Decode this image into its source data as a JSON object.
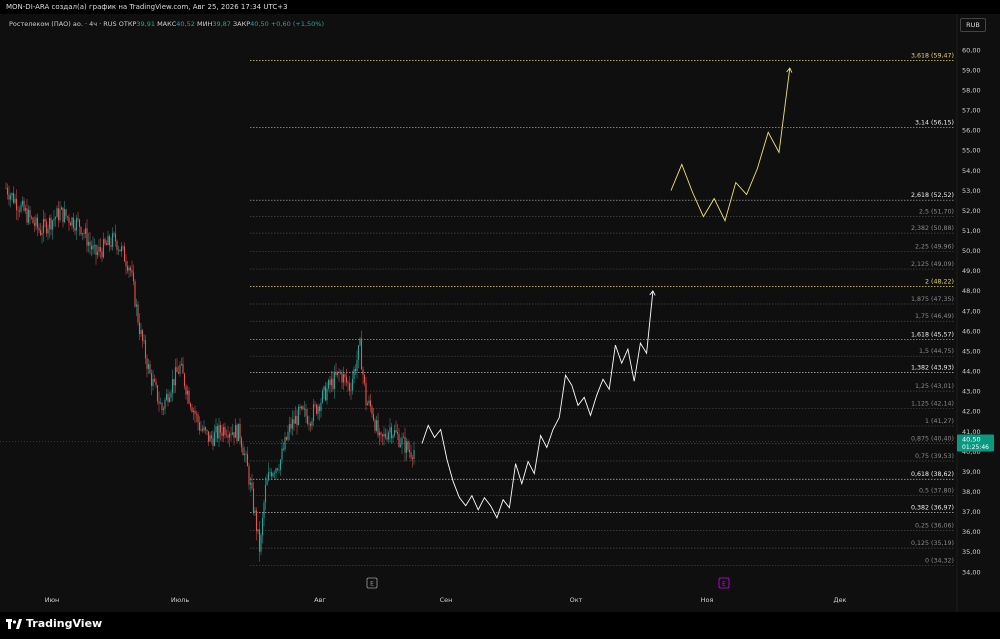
{
  "header": {
    "title": "MON-DI-ARA создал(а) график на TradingView.com, Авг 25, 2026 17:34 UTC+3"
  },
  "legend": {
    "symbol": "Ростелеком (ПАО) ао. · 4ч · RUS",
    "open_label": "ОТКР",
    "open": "39,91",
    "high_label": "МАКС",
    "high": "40,52",
    "low_label": "МИН",
    "low": "39,87",
    "close_label": "ЗАКР",
    "close": "40,50",
    "change": "+0,60 (+1,50%)"
  },
  "currency": "RUB",
  "price_badge": {
    "price": "40,50",
    "countdown": "01:25:46"
  },
  "colors": {
    "up": "#26a69a",
    "down": "#ef5350",
    "gold": "#e9d36b",
    "projection": "#ffffff",
    "projection2": "#f2e36b"
  },
  "y_axis": [
    "60,00",
    "59,00",
    "58,00",
    "57,00",
    "56,00",
    "55,00",
    "54,00",
    "53,00",
    "52,00",
    "51,00",
    "50,00",
    "49,00",
    "48,00",
    "47,00",
    "46,00",
    "45,00",
    "44,00",
    "43,00",
    "42,00",
    "41,00",
    "40,00",
    "39,00",
    "38,00",
    "37,00",
    "36,00",
    "35,00",
    "34,00"
  ],
  "x_axis": [
    "Июн",
    "Июль",
    "Авг",
    "Сен",
    "Окт",
    "Ноя",
    "Дек"
  ],
  "event_markers": [
    "E",
    "E"
  ],
  "fib_levels": [
    {
      "label": "3,618 (59,47)",
      "price": 59.47,
      "style": "gold"
    },
    {
      "label": "3,14 (56,15)",
      "price": 56.15,
      "style": "bright"
    },
    {
      "label": "2,618 (52,52)",
      "price": 52.52,
      "style": "bright"
    },
    {
      "label": "2,5 (51,70)",
      "price": 51.7,
      "style": "dim"
    },
    {
      "label": "2,382 (50,88)",
      "price": 50.88,
      "style": "dim"
    },
    {
      "label": "2,25 (49,96)",
      "price": 49.96,
      "style": "dim"
    },
    {
      "label": "2,125 (49,09)",
      "price": 49.09,
      "style": "dim"
    },
    {
      "label": "2 (48,22)",
      "price": 48.22,
      "style": "gold"
    },
    {
      "label": "1,875 (47,35)",
      "price": 47.35,
      "style": "dim"
    },
    {
      "label": "1,75 (46,49)",
      "price": 46.49,
      "style": "dim"
    },
    {
      "label": "1,618 (45,57)",
      "price": 45.57,
      "style": "bright"
    },
    {
      "label": "1,5 (44,75)",
      "price": 44.75,
      "style": "dim"
    },
    {
      "label": "1,382 (43,93)",
      "price": 43.93,
      "style": "bright"
    },
    {
      "label": "1,25 (43,01)",
      "price": 43.01,
      "style": "dim"
    },
    {
      "label": "1,125 (42,14)",
      "price": 42.14,
      "style": "dim"
    },
    {
      "label": "1 (41,27)",
      "price": 41.27,
      "style": "dim"
    },
    {
      "label": "0,875 (40,40)",
      "price": 40.4,
      "style": "dim"
    },
    {
      "label": "0,75 (39,53)",
      "price": 39.53,
      "style": "dim"
    },
    {
      "label": "0,618 (38,62)",
      "price": 38.62,
      "style": "bright"
    },
    {
      "label": "0,5 (37,80)",
      "price": 37.8,
      "style": "dim"
    },
    {
      "label": "0,382 (36,97)",
      "price": 36.97,
      "style": "bright"
    },
    {
      "label": "0,25 (36,06)",
      "price": 36.06,
      "style": "dim"
    },
    {
      "label": "0,125 (35,19)",
      "price": 35.19,
      "style": "dim"
    },
    {
      "label": "0 (34,32)",
      "price": 34.32,
      "style": "dim"
    }
  ],
  "projection_white": [
    [
      0,
      40.4
    ],
    [
      1,
      41.3
    ],
    [
      2,
      40.7
    ],
    [
      3,
      41.1
    ],
    [
      4,
      39.6
    ],
    [
      5,
      38.5
    ],
    [
      6,
      37.7
    ],
    [
      7,
      37.3
    ],
    [
      8,
      37.8
    ],
    [
      9,
      37.1
    ],
    [
      10,
      37.7
    ],
    [
      11,
      37.3
    ],
    [
      12,
      36.7
    ],
    [
      13,
      37.6
    ],
    [
      14,
      37.2
    ],
    [
      15,
      39.4
    ],
    [
      16,
      38.4
    ],
    [
      17,
      39.5
    ],
    [
      18,
      38.9
    ],
    [
      19,
      40.8
    ],
    [
      20,
      40.2
    ],
    [
      21,
      41.1
    ],
    [
      22,
      41.7
    ],
    [
      23,
      43.8
    ],
    [
      24,
      43.3
    ],
    [
      25,
      42.3
    ],
    [
      26,
      42.7
    ],
    [
      27,
      41.8
    ],
    [
      28,
      42.8
    ],
    [
      29,
      43.6
    ],
    [
      30,
      43.1
    ],
    [
      31,
      45.3
    ],
    [
      32,
      44.4
    ],
    [
      33,
      45.1
    ],
    [
      34,
      43.5
    ],
    [
      35,
      45.4
    ],
    [
      36,
      44.9
    ],
    [
      37,
      48.0
    ]
  ],
  "projection_yellow": [
    [
      0,
      53.0
    ],
    [
      1,
      54.3
    ],
    [
      2,
      52.9
    ],
    [
      3,
      51.7
    ],
    [
      4,
      52.6
    ],
    [
      5,
      51.5
    ],
    [
      6,
      53.4
    ],
    [
      7,
      52.8
    ],
    [
      8,
      54.1
    ],
    [
      9,
      55.9
    ],
    [
      10,
      54.9
    ],
    [
      11,
      59.1
    ]
  ],
  "footer": {
    "brand": "TradingView"
  }
}
